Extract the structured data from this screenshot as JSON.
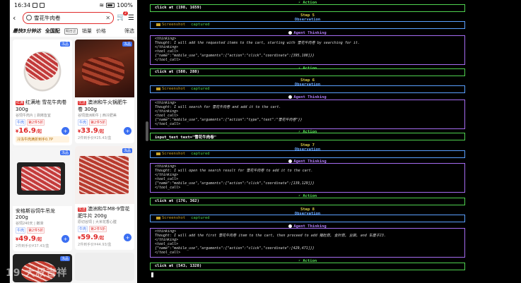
{
  "phone": {
    "status": {
      "time": "16:34",
      "battery": "100%"
    },
    "search": {
      "query": "雪花牛肉卷",
      "cart_badge": "2"
    },
    "filters": {
      "f1": "最快3分钟达",
      "f2": "全国配",
      "tag": "明日达",
      "sales": "销量",
      "price": "价格",
      "filter": "筛选"
    },
    "products": [
      {
        "title": "红满地 雪花牛肉卷300g",
        "brand": "红满",
        "sub": "谷饲牛肉片 | 涮烤皆宜",
        "chip1": "牛肉",
        "chip2": "第2件5折",
        "price": "16.9",
        "unit": "/起",
        "promo": "冷冻牛肉满折到手0.7P",
        "corner": "冻品"
      },
      {
        "title": "澳洲和牛火锅肥牛卷 300g",
        "brand": "优选",
        "sub": "谷饲澳洲和牛 | 西冷肥美",
        "chip1": "牛肉",
        "chip2": "第2件5折",
        "price": "33.9",
        "unit": "/起",
        "hand": "2件到手价¥25.43/盒",
        "corner": "冻品"
      },
      {
        "title": "安格斯谷饲牛吊龙 200g",
        "brand": "",
        "sub": "谷饲240天 | 嫩滑",
        "chip1": "牛肉",
        "chip2": "第2件5折",
        "price": "49.9",
        "unit": "/起",
        "hand": "2件到手价¥37.43/盒",
        "corner": "冻品"
      },
      {
        "title": "澳洲和牛M8-9雪花肥牛片 200g",
        "brand": "优选",
        "sub": "原切谷饲 | 大米花香心膛",
        "chip1": "牛肉",
        "chip2": "第2件5折",
        "price": "59.9",
        "unit": "/起",
        "hand": "2件到手价¥44.93/盒",
        "corner": "冻品"
      },
      {
        "corner": "冻品"
      },
      {
        "corner": ""
      }
    ],
    "watermark": "19 大叔吉祥"
  },
  "log": {
    "prev_action": "click at (198, 1659)",
    "steps": [
      {
        "step": "Step 5",
        "screenshot": "Screenshot",
        "captured": "captured",
        "thinking_open": "<thinking>",
        "thought": "Thought: I will add the requested items to the cart, starting with 雪花牛肉卷 by searching for it.",
        "thinking_close": "</thinking>",
        "tool_open": "<tool_call>",
        "tool_json": "{\"name\":\"mobile_use\",\"arguments\":{\"action\":\"click\",\"coordinate\":[395,108]}}",
        "tool_close": "</tool_call>",
        "action": "click at (580, 288)"
      },
      {
        "step": "Step 6",
        "screenshot": "Screenshot",
        "captured": "captured",
        "thinking_open": "<thinking>",
        "thought": "Thought: I will search for 雪花牛肉卷 and add it to the cart.",
        "thinking_close": "</thinking>",
        "tool_open": "<tool_call>",
        "tool_json": "{\"name\":\"mobile_use\",\"arguments\":{\"action\":\"type\",\"text\":\"雪花牛肉卷\"}}",
        "tool_close": "</tool_call>",
        "action": "input_text text=\"雪花牛肉卷\""
      },
      {
        "step": "Step 7",
        "screenshot": "Screenshot",
        "captured": "captured",
        "thinking_open": "<thinking>",
        "thought": "Thought: I will open the search result for 雪花牛肉卷 to add it to the cart.",
        "thinking_close": "</thinking>",
        "tool_open": "<tool_call>",
        "tool_json": "{\"name\":\"mobile_use\",\"arguments\":{\"action\":\"click\",\"coordinate\":[139,129]}}",
        "tool_close": "</tool_call>",
        "action": "click at (176, 362)"
      },
      {
        "step": "Step 8",
        "screenshot": "Screenshot",
        "captured": "captured",
        "thinking_open": "<thinking>",
        "thought": "Thought: I will add the first 雪花牛肉卷 item to the cart, then proceed to add 猪肚菇, 金针菇, 豆腐, and 车厘子J3.",
        "thinking_close": "</thinking>",
        "tool_open": "<tool_call>",
        "tool_json": "{\"name\":\"mobile_use\",\"arguments\":{\"action\":\"click\",\"coordinate\":[429,471]}}",
        "tool_close": "</tool_call>",
        "action": "click at (543, 1328)"
      }
    ],
    "labels": {
      "action": "Action",
      "observation": "Observation",
      "agent_thinking": "Agent Thinking"
    }
  }
}
